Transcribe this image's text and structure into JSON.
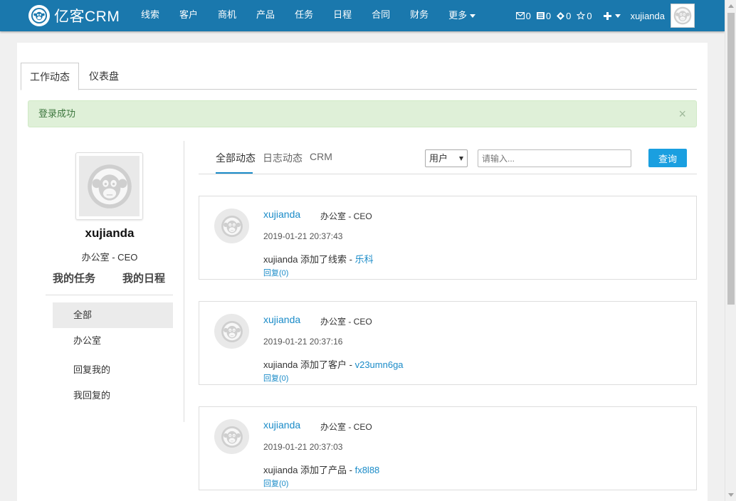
{
  "navbar": {
    "logo_text": "亿客CRM",
    "items": [
      {
        "label": "线索"
      },
      {
        "label": "客户"
      },
      {
        "label": "商机"
      },
      {
        "label": "产品"
      },
      {
        "label": "任务"
      },
      {
        "label": "日程"
      },
      {
        "label": "合同"
      },
      {
        "label": "财务"
      },
      {
        "label": "更多"
      }
    ],
    "stats": {
      "messages": "0",
      "tasks": "0",
      "events": "0",
      "favorites": "0"
    },
    "username": "xujianda",
    "color": "#1a78ad"
  },
  "tabs": [
    {
      "label": "工作动态",
      "active": true
    },
    {
      "label": "仪表盘",
      "active": false
    }
  ],
  "alert": {
    "message": "登录成功",
    "close": "×"
  },
  "profile": {
    "name": "xujianda",
    "role": "办公室 - CEO",
    "link_tasks": "我的任务",
    "link_schedule": "我的日程"
  },
  "filters": [
    {
      "label": "全部",
      "active": true
    },
    {
      "label": "办公室",
      "active": false
    },
    {
      "label": "回复我的",
      "active": false
    },
    {
      "label": "我回复的",
      "active": false
    }
  ],
  "feed": {
    "tabs": [
      {
        "label": "全部动态",
        "active": true
      },
      {
        "label": "日志动态",
        "active": false
      },
      {
        "label": "CRM",
        "active": false
      }
    ],
    "select_value": "用户",
    "search_placeholder": "请输入...",
    "search_button": "查询",
    "items": [
      {
        "user": "xujianda",
        "role": "办公室 - CEO",
        "time": "2019-01-21 20:37:43",
        "action": "xujianda 添加了线索 - ",
        "target": "乐科",
        "reply": "回复(0)"
      },
      {
        "user": "xujianda",
        "role": "办公室 - CEO",
        "time": "2019-01-21 20:37:16",
        "action": "xujianda 添加了客户 - ",
        "target": "v23umn6ga",
        "reply": "回复(0)"
      },
      {
        "user": "xujianda",
        "role": "办公室 - CEO",
        "time": "2019-01-21 20:37:03",
        "action": "xujianda 添加了产品 - ",
        "target": "fx8l88",
        "reply": "回复(0)"
      }
    ]
  },
  "colors": {
    "accent": "#1a8bc8",
    "button": "#1a9fe0",
    "alert_bg": "#dff0d8"
  },
  "icons": [
    "monkey-logo-icon",
    "envelope-icon",
    "task-list-icon",
    "event-icon",
    "star-icon",
    "plus-icon",
    "caret-down-icon",
    "monkey-avatar-icon",
    "close-icon"
  ]
}
